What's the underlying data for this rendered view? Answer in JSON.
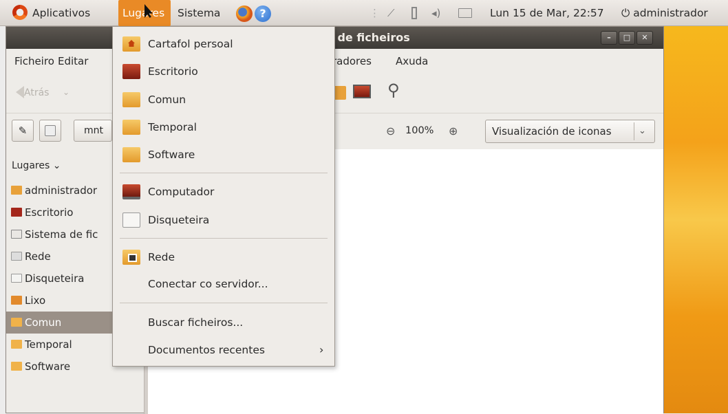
{
  "top_panel": {
    "applications_label": "Aplicativos",
    "places_label": "Lugares",
    "system_label": "Sistema",
    "clock": "Lun 15 de Mar, 22:57",
    "user_label": "administrador"
  },
  "window": {
    "title_partial": "r de ficheiros",
    "menubar": {
      "ficheiro": "Ficheiro",
      "editar": "Editar",
      "marcadores_partial": "radores",
      "axuda": "Axuda"
    },
    "toolbar": {
      "back_label": "Atrás"
    },
    "location": {
      "path_segment": "mnt",
      "zoom": "100%",
      "view_mode": "Visualización de iconas"
    },
    "side_pane": {
      "header": "Lugares",
      "items": [
        {
          "label": "administrador",
          "icon": "home-folder-icon"
        },
        {
          "label": "Escritorio",
          "icon": "desktop-icon"
        },
        {
          "label": "Sistema de fic",
          "icon": "filesystem-icon"
        },
        {
          "label": "Rede",
          "icon": "network-icon"
        },
        {
          "label": "Disqueteira",
          "icon": "floppy-icon"
        },
        {
          "label": "Lixo",
          "icon": "trash-icon"
        },
        {
          "label": "Comun",
          "icon": "folder-icon",
          "selected": true
        },
        {
          "label": "Temporal",
          "icon": "folder-icon"
        },
        {
          "label": "Software",
          "icon": "folder-icon"
        }
      ]
    }
  },
  "places_menu": {
    "items": [
      {
        "label": "Cartafol persoal",
        "icon": "home-folder-icon"
      },
      {
        "label": "Escritorio",
        "icon": "desktop-icon"
      },
      {
        "label": "Comun",
        "icon": "folder-icon"
      },
      {
        "label": "Temporal",
        "icon": "folder-icon"
      },
      {
        "label": "Software",
        "icon": "folder-icon"
      },
      {
        "label": "Computador",
        "icon": "computer-icon"
      },
      {
        "label": "Disqueteira",
        "icon": "floppy-icon"
      },
      {
        "label": "Rede",
        "icon": "network-icon"
      },
      {
        "label": "Conectar co servidor...",
        "icon": ""
      },
      {
        "label": "Buscar ficheiros...",
        "icon": ""
      },
      {
        "label": "Documentos recentes",
        "icon": ""
      }
    ]
  },
  "colors": {
    "panel_highlight": "#e98a26",
    "titlebar": "#3d3a36",
    "selection": "#9a9087",
    "desktop_accent": "#f4a21a"
  }
}
